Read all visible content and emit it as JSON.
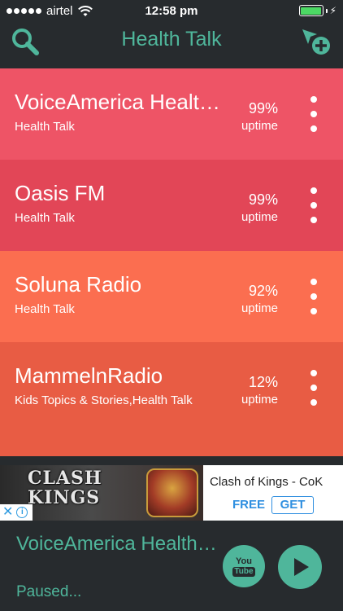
{
  "status_bar": {
    "carrier": "airtel",
    "time": "12:58 pm",
    "signal_bars": 5,
    "battery_level": 1.0,
    "battery_color": "#4cd964"
  },
  "nav": {
    "title": "Health Talk",
    "search_icon": "search-icon",
    "add_icon": "add-station-icon",
    "accent_color": "#4fb69b"
  },
  "stations": [
    {
      "name": "VoiceAmerica Health Talk",
      "genre": "Health Talk",
      "uptime_pct": "99%",
      "uptime_label": "uptime",
      "color": "#ee5466"
    },
    {
      "name": "Oasis FM",
      "genre": "Health Talk",
      "uptime_pct": "99%",
      "uptime_label": "uptime",
      "color": "#e24657"
    },
    {
      "name": "Soluna Radio",
      "genre": "Health Talk",
      "uptime_pct": "92%",
      "uptime_label": "uptime",
      "color": "#fb6e50"
    },
    {
      "name": "MammelnRadio",
      "genre": "Kids Topics & Stories,Health Talk",
      "uptime_pct": "12%",
      "uptime_label": "uptime",
      "color": "#e85c44"
    }
  ],
  "ad": {
    "game_title_line1": "CLASH",
    "game_title_line2": "KINGS",
    "app_name": "Clash of Kings - CoK",
    "price": "FREE",
    "cta": "GET"
  },
  "player": {
    "now_playing": "VoiceAmerica Health Talk",
    "status": "Paused...",
    "youtube_you": "You",
    "youtube_tube": "Tube",
    "play_icon": "play-icon"
  }
}
